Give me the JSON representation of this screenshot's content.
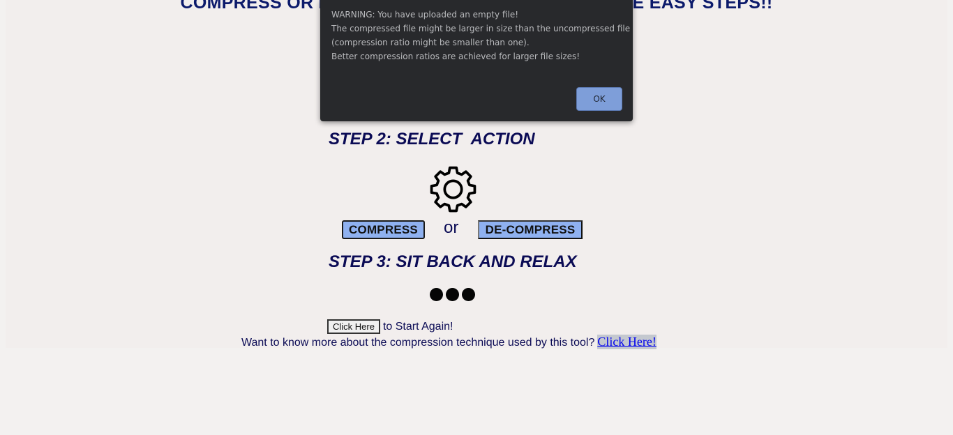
{
  "page": {
    "headline": "COMPRESS OR DECOMPRESS YOUR FILES IN THREE EASY STEPS!!",
    "step2_heading": "STEP 2: SELECT  ACTION",
    "step3_heading": "STEP 3: SIT BACK AND RELAX",
    "actions": {
      "compress_label": "COMPRESS",
      "or_label": "or",
      "decompress_label": "DE-COMPRESS"
    },
    "icons": {
      "action_icon": "gear-icon",
      "progress_icon": "loading-dots-icon"
    },
    "restart": {
      "button_label": "Click Here",
      "suffix_text": "to Start Again!"
    },
    "info": {
      "text": "Want to know more about the compression technique used by this tool?",
      "link_label": "Click Here!"
    }
  },
  "dialog": {
    "lines": [
      "WARNING: You have uploaded an empty file!",
      "The compressed file might be larger in size than the uncompressed file",
      "(compression ratio might be smaller than one).",
      "Better compression ratios are achieved for larger file sizes!"
    ],
    "ok_label": "OK"
  },
  "colors": {
    "heading": "#0b0b55",
    "action_button": "#8fb1f0",
    "dialog_background": "#28292c",
    "dialog_ok": "#7e9ed9",
    "link": "#0000ee"
  }
}
